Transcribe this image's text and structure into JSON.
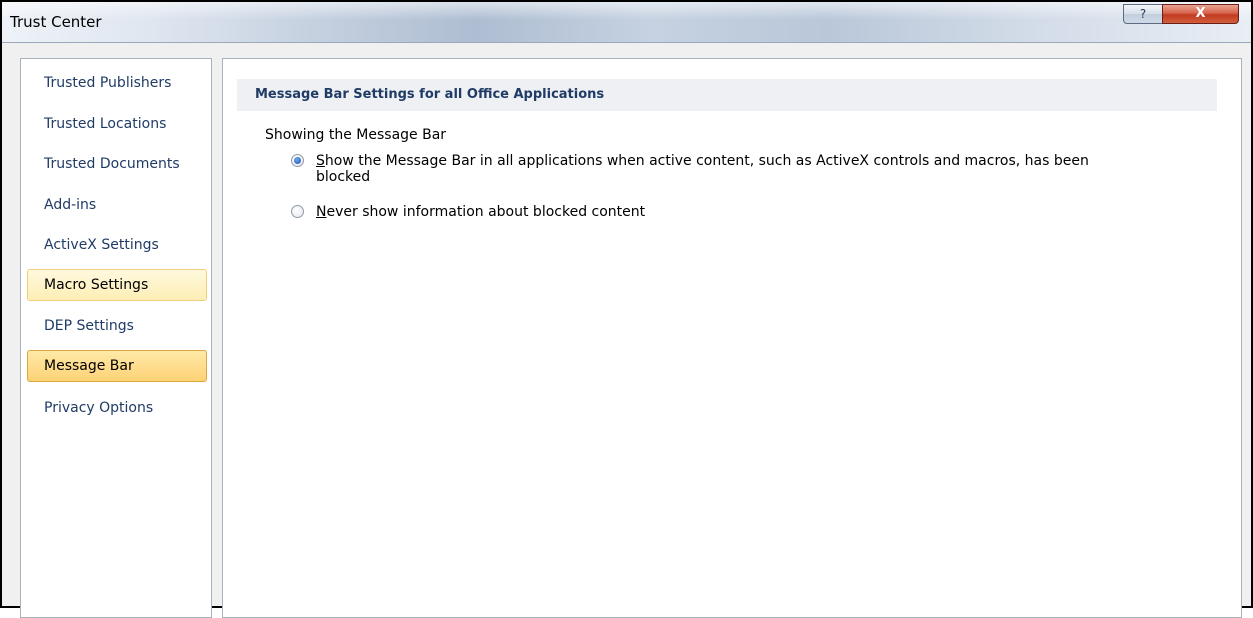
{
  "window": {
    "title": "Trust Center",
    "help_label": "?",
    "close_label": "X"
  },
  "sidebar": {
    "items": [
      {
        "label": "Trusted Publishers"
      },
      {
        "label": "Trusted Locations"
      },
      {
        "label": "Trusted Documents"
      },
      {
        "label": "Add-ins"
      },
      {
        "label": "ActiveX Settings"
      },
      {
        "label": "Macro Settings"
      },
      {
        "label": "DEP Settings"
      },
      {
        "label": "Message Bar"
      },
      {
        "label": "Privacy Options"
      }
    ],
    "hovered": "Macro Settings",
    "selected": "Message Bar"
  },
  "content": {
    "section_title": "Message Bar Settings for all Office Applications",
    "group_label": "Showing the Message Bar",
    "options": [
      {
        "accel": "S",
        "rest_line1": "how the Message Bar in all applications when active content, such as ActiveX controls and macros, has been",
        "line2": "blocked",
        "checked": true
      },
      {
        "accel": "N",
        "rest_line1": "ever show information about blocked content",
        "line2": "",
        "checked": false
      }
    ]
  },
  "colors": {
    "nav_text": "#1f3b66",
    "selected_bg": "#fdd275",
    "hover_bg": "#fdeeb5",
    "header_bg": "#eef0f3"
  }
}
